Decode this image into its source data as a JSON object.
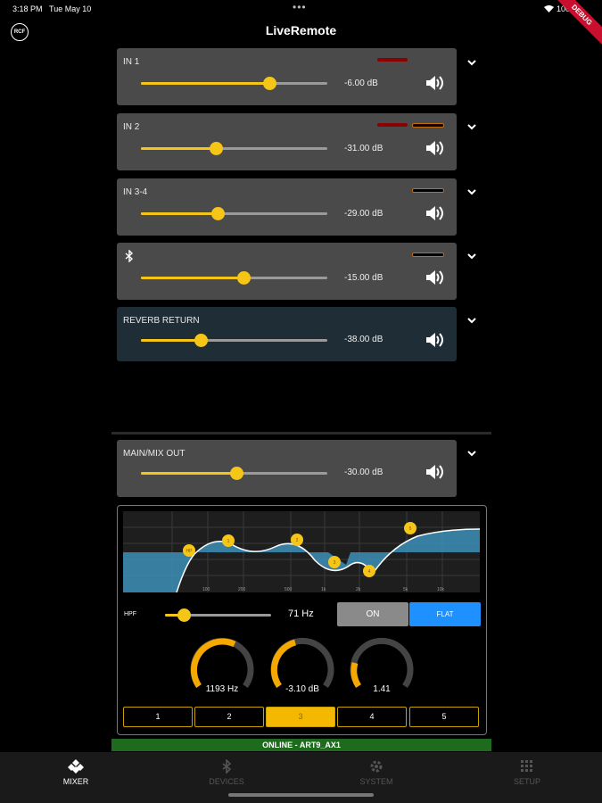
{
  "status_bar": {
    "time": "3:18 PM",
    "date": "Tue May 10",
    "battery": "100%",
    "dots": "•••",
    "debug_banner": "DEBUG"
  },
  "header": {
    "logo": "RCF",
    "title": "LiveRemote"
  },
  "channels": [
    {
      "name": "IN 1",
      "level": "-6.00 dB",
      "fader": 0.69
    },
    {
      "name": "IN 2",
      "level": "-31.00 dB",
      "fader": 0.4
    },
    {
      "name": "IN 3-4",
      "level": "-29.00 dB",
      "fader": 0.41
    },
    {
      "name": "",
      "icon": "bluetooth-icon",
      "level": "-15.00 dB",
      "fader": 0.55
    },
    {
      "name": "REVERB RETURN",
      "level": "-38.00 dB",
      "fader": 0.32
    }
  ],
  "main": {
    "name": "MAIN/MIX OUT",
    "level": "-30.00 dB",
    "fader": 0.51
  },
  "eq": {
    "freq_labels": [
      "100",
      "200",
      "500",
      "1k",
      "2k",
      "5k",
      "10k"
    ],
    "band_points": [
      "HP",
      "1",
      "2",
      "3",
      "4",
      "5"
    ],
    "hpf_label": "HPF",
    "hpf_value": "71 Hz",
    "hpf_slider": 0.18,
    "on_label": "ON",
    "flat_label": "FLAT",
    "frequency": "1193 Hz",
    "gain": "-3.10 dB",
    "q": "1.41",
    "bands": [
      "1",
      "2",
      "3",
      "4",
      "5"
    ],
    "selected_band": "3"
  },
  "connection": "ONLINE - ART9_AX1",
  "tabs": [
    {
      "label": "MIXER",
      "icon": "mixer-icon"
    },
    {
      "label": "DEVICES",
      "icon": "bluetooth-icon"
    },
    {
      "label": "SYSTEM",
      "icon": "gear-icon"
    },
    {
      "label": "SETUP",
      "icon": "grid-icon"
    }
  ],
  "colors": {
    "accent": "#f5c518",
    "eq_fill": "#3c8fb8",
    "online": "#1e6b1e",
    "flat_button": "#1e90ff"
  }
}
